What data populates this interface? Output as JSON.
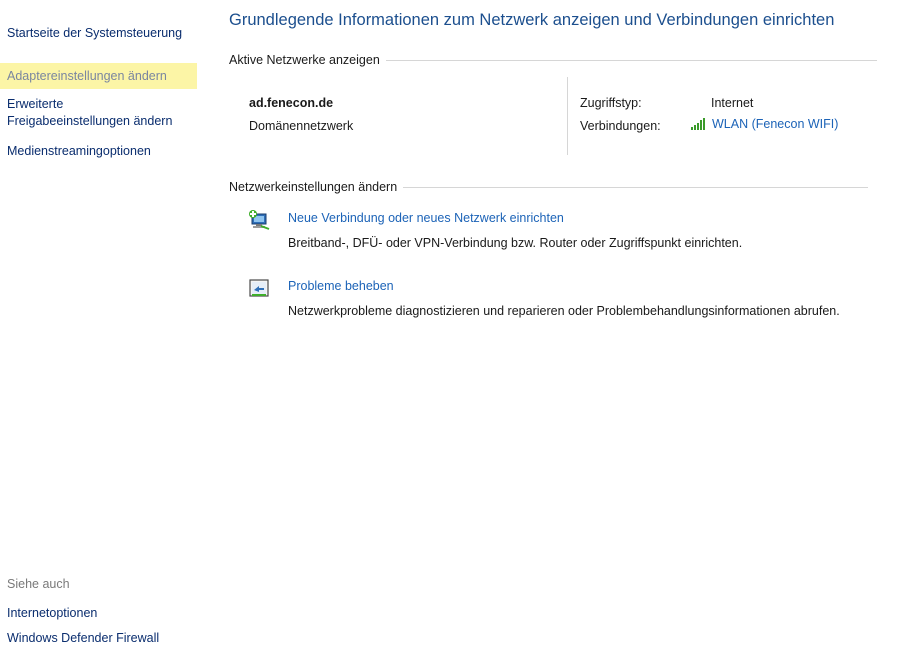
{
  "sidebar": {
    "home_link": "Startseite der Systemsteuerung",
    "adapter_link": "Adaptereinstellungen ändern",
    "advanced_sharing_line1": "Erweiterte",
    "advanced_sharing_line2": "Freigabeeinstellungen ändern",
    "media_streaming": "Medienstreamingoptionen",
    "see_also_label": "Siehe auch",
    "internet_options": "Internetoptionen",
    "defender_firewall": "Windows Defender Firewall"
  },
  "main": {
    "title": "Grundlegende Informationen zum Netzwerk anzeigen und Verbindungen einrichten",
    "active_networks_header": "Aktive Netzwerke anzeigen",
    "network": {
      "name": "ad.fenecon.de",
      "type": "Domänennetzwerk",
      "access_type_label": "Zugriffstyp:",
      "access_type_value": "Internet",
      "connections_label": "Verbindungen:",
      "connection_value": "WLAN (Fenecon WIFI)"
    },
    "change_settings_header": "Netzwerkeinstellungen ändern",
    "tasks": [
      {
        "link": "Neue Verbindung oder neues Netzwerk einrichten",
        "description": "Breitband-, DFÜ- oder VPN-Verbindung bzw. Router oder Zugriffspunkt einrichten."
      },
      {
        "link": "Probleme beheben",
        "description": "Netzwerkprobleme diagnostizieren und reparieren oder Problembehandlungsinformationen abrufen."
      }
    ]
  },
  "colors": {
    "title": "#1c4f8e",
    "link": "#1c63b7",
    "highlight": "#fcf5a6",
    "signal": "#3a9a2a"
  },
  "icons": {
    "signal": "wifi-signal-icon",
    "setup": "network-setup-icon",
    "troubleshoot": "troubleshoot-icon"
  }
}
